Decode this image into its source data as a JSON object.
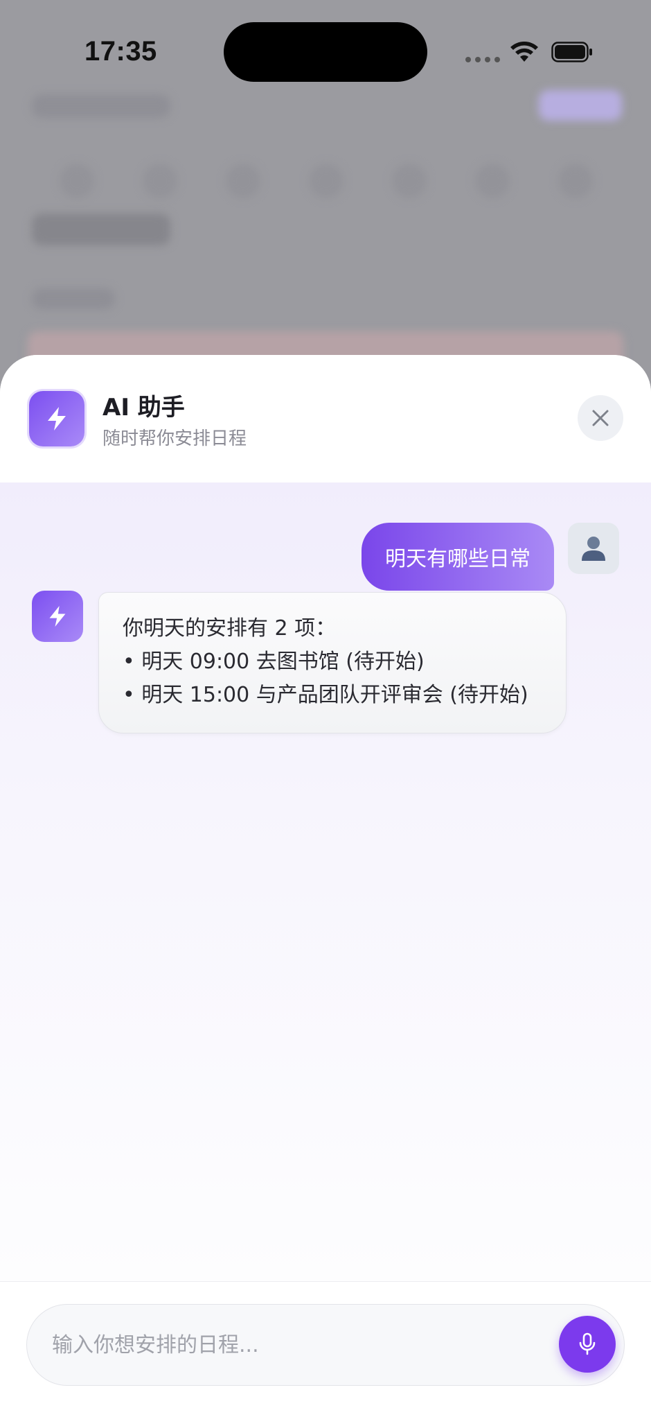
{
  "status_bar": {
    "time": "17:35"
  },
  "assistant": {
    "title": "AI 助手",
    "subtitle": "随时帮你安排日程",
    "icon": "lightning-icon",
    "close_icon": "close-icon",
    "accent_color": "#7c3aed"
  },
  "messages": [
    {
      "role": "user",
      "text": "明天有哪些日常",
      "avatar_icon": "user-avatar-icon"
    },
    {
      "role": "assistant",
      "lines": [
        "你明天的安排有 2 项：",
        "• 明天 09:00 去图书馆 (待开始)",
        "• 明天 15:00 与产品团队开评审会 (待开始)"
      ]
    }
  ],
  "composer": {
    "placeholder": "输入你想安排的日程...",
    "mic_icon": "microphone-icon"
  }
}
